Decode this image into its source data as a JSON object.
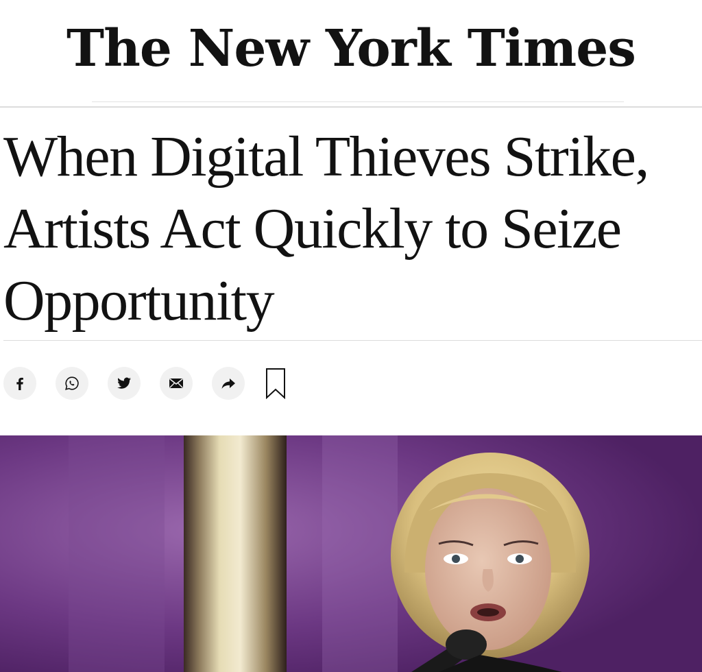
{
  "masthead": {
    "logo_text": "The New York Times"
  },
  "article": {
    "headline": "When Digital Thieves Strike, Artists Act Quickly to Seize Opportunity"
  },
  "share": {
    "icons": [
      "facebook-icon",
      "whatsapp-icon",
      "twitter-icon",
      "email-icon",
      "share-arrow-icon",
      "bookmark-icon"
    ]
  },
  "colors": {
    "text": "#121212",
    "share_button_bg": "#f1f1f1",
    "photo_purple": "#6e3b86",
    "hair_blonde": "#d9bf7e"
  }
}
